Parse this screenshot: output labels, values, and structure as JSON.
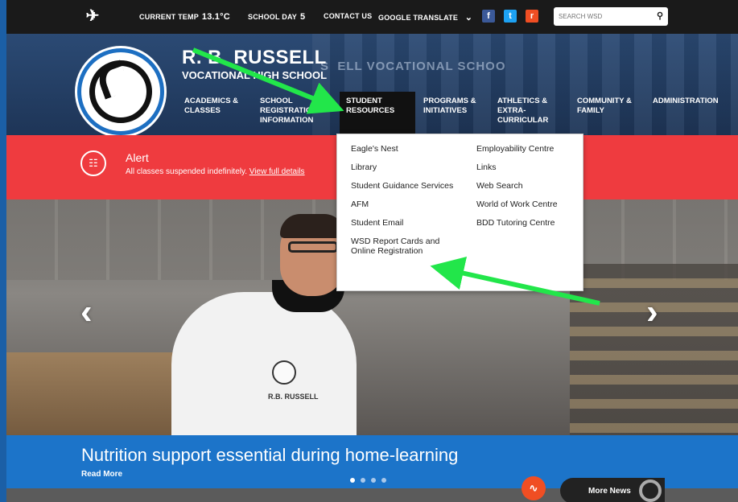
{
  "topbar": {
    "current_temp_label": "CURRENT TEMP",
    "current_temp_value": "13.1°C",
    "school_day_label": "SCHOOL DAY",
    "school_day_value": "5",
    "contact": "CONTACT US",
    "translate": "GOOGLE TRANSLATE",
    "translate_chevron": "⌄",
    "social": [
      {
        "icon": "facebook-icon",
        "glyph": "f",
        "color": "#3b5998"
      },
      {
        "icon": "twitter-icon",
        "glyph": "t",
        "color": "#1da1f2"
      },
      {
        "icon": "rss-icon",
        "glyph": "r",
        "color": "#f04e23"
      }
    ],
    "search_placeholder": "SEARCH WSD"
  },
  "header": {
    "school_name": "R. B. RUSSELL",
    "school_subtitle": "VOCATIONAL HIGH SCHOOL",
    "nav": [
      {
        "label": "ACADEMICS & CLASSES"
      },
      {
        "label": "SCHOOL REGISTRATION INFORMATION"
      },
      {
        "label": "STUDENT RESOURCES"
      },
      {
        "label": "PROGRAMS & INITIATIVES"
      },
      {
        "label": "ATHLETICS & EXTRA-CURRICULAR"
      },
      {
        "label": "COMMUNITY & FAMILY"
      },
      {
        "label": "ADMINISTRATION"
      }
    ]
  },
  "dropdown": {
    "left": [
      "Eagle's Nest",
      "Library",
      "Student Guidance Services",
      "AFM",
      "Student Email",
      "WSD Report Cards and Online Registration"
    ],
    "right": [
      "Employability Centre",
      "Links",
      "Web Search",
      "World of Work Centre",
      "BDD Tutoring Centre"
    ]
  },
  "alert": {
    "title": "Alert",
    "message": "All classes suspended indefinitely.",
    "link": "View full details"
  },
  "hero": {
    "chef_text": "R.B. RUSSELL",
    "prev": "‹",
    "next": "›"
  },
  "caption": {
    "headline": "Nutrition support essential during home-learning",
    "read_more": "Read More",
    "slides_total": 4,
    "slide_active": 1
  },
  "footer": {
    "more_news": "More News"
  },
  "colors": {
    "alert_red": "#ef3b3f",
    "caption_blue": "#1c74c9",
    "annotation_green": "#22e64a"
  }
}
